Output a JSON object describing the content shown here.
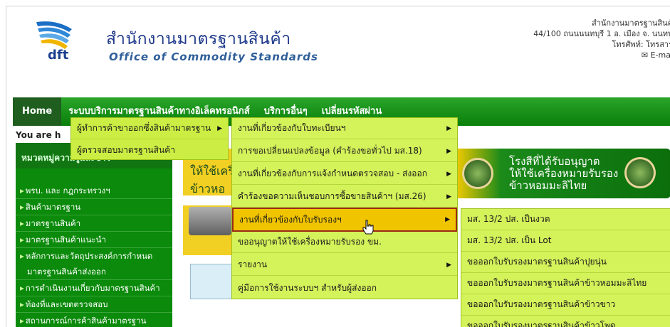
{
  "header": {
    "logo_text": "dft",
    "title_th": "สำนักงานมาตรฐานสินค้า",
    "title_en": "Office of Commodity Standards",
    "contact_lines": [
      "สำนักงานมาตรฐานสินค้",
      "44/100 ถนนนนทบุรี 1 อ. เมือง จ. นนทบุ",
      "โทรศัพท์: โทรสาร"
    ],
    "email_label": "E-mai"
  },
  "nav": {
    "items": [
      "Home",
      "ระบบบริการมาตรฐานสินค้าทางอิเล็คทรอนิกส์",
      "บริการอื่นๆ",
      "เปลี่ยนรหัสผ่าน"
    ]
  },
  "breadcrumb": "You are h",
  "sidebar": {
    "heading": "หมวดหมู่ความรู้และข่าว",
    "items": [
      "พรบ. และ กฎกระทรวงฯ",
      "สินค้ามาตรฐาน",
      "มาตรฐานสินค้า",
      "มาตรฐานสินค้าแนะนำ",
      "หลักการและวัตถุประสงค์การกำหนด",
      "มาตรฐานสินค้าส่งออก",
      "การดำเนินงานเกี่ยวกับมาตรฐานสินค้า",
      "ท้องที่และเขตตรวจสอบ",
      "สถานการณ์การค้าสินค้ามาตรฐาน"
    ]
  },
  "banners": {
    "b1_line1": "ให้ใช้เครื่",
    "b1_line2": "ข้าวหอ",
    "b2_line1": "โรงสีที่ได้รับอนุญาต",
    "b2_line2": "ให้ใช้เครื่องหมายรับรอง",
    "b2_line3": "ข้าวหอมมะลิไทย"
  },
  "menu_level1": [
    {
      "label": "ผู้ทำการค้าขาออกซึ่งสินค้ามาตรฐาน",
      "has_submenu": true
    },
    {
      "label": "ผู้ตรวจสอบมาตรฐานสินค้า",
      "has_submenu": false
    }
  ],
  "menu_level2": [
    {
      "label": "งานที่เกี่ยวข้องกับใบทะเบียนฯ",
      "has_submenu": true
    },
    {
      "label": "การขอเปลี่ยนแปลงข้อมูล (คำร้องขอทั่วไป มส.18)",
      "has_submenu": true
    },
    {
      "label": "งานที่เกี่ยวข้องกับการแจ้งกำหนดตรวจสอบ - ส่งออก",
      "has_submenu": true
    },
    {
      "label": "คำร้องขอความเห็นชอบการซื้อขายสินค้าฯ (มส.26)",
      "has_submenu": true
    },
    {
      "label": "งานที่เกี่ยวข้องกับใบรับรองฯ",
      "has_submenu": true
    },
    {
      "label": "ขออนุญาตให้ใช้เครื่องหมายรับรอง ขม.",
      "has_submenu": false
    },
    {
      "label": "รายงาน",
      "has_submenu": true
    },
    {
      "label": "คู่มือการใช้งานระบบฯ สำหรับผู้ส่งออก",
      "has_submenu": false
    }
  ],
  "menu_level3": [
    "มส. 13/2 ปส. เป็นงวด",
    "มส. 13/2 ปส. เป็น Lot",
    "ขอออกใบรับรองมาตรฐานสินค้าปุยนุ่น",
    "ขอออกใบรับรองมาตรฐานสินค้าข้าวหอมมะลิไทย",
    "ขอออกใบรับรองมาตรฐานสินค้าข้าวขาว",
    "ขอออกใบรับรองมาตรฐานสินค้าข้าวโพด"
  ],
  "icons": {
    "submenu": "arrow-right-icon",
    "mail": "mail-icon",
    "cursor": "hand-cursor-icon"
  },
  "colors": {
    "nav_green": "#0a7f0a",
    "menu_lime": "#ccee44",
    "active_gold": "#f1c400",
    "active_border": "#9b2a1a"
  }
}
